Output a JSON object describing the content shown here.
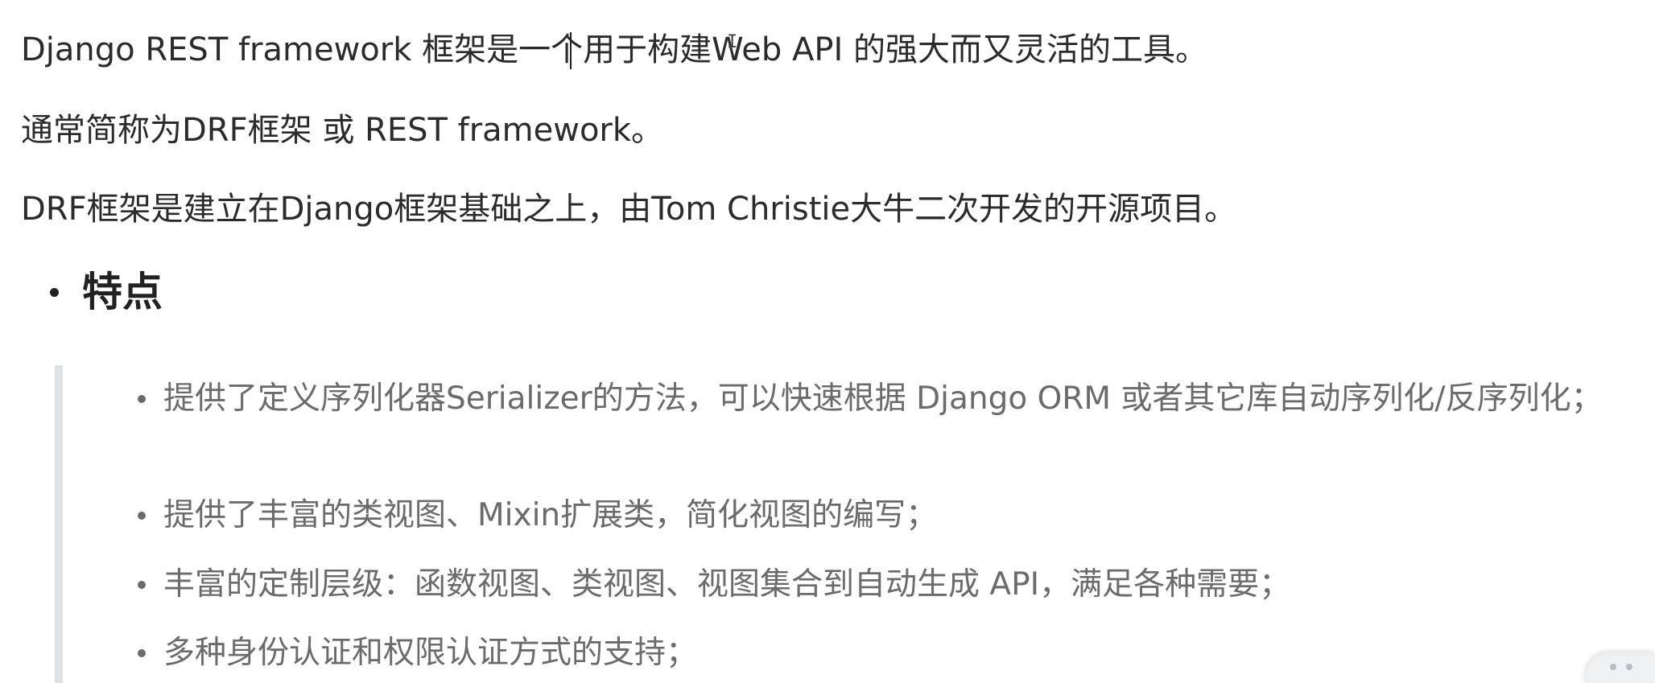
{
  "intro": {
    "line1": "Django REST framework 框架是一个用于构建Web API 的强大而又灵活的工具。",
    "line2": "通常简称为DRF框架 或 REST framework。",
    "line3": "DRF框架是建立在Django框架基础之上，由Tom Christie大牛二次开发的开源项目。"
  },
  "features": {
    "heading": "特点",
    "items": [
      "提供了定义序列化器Serializer的方法，可以快速根据 Django ORM 或者其它库自动序列化/反序列化；",
      "提供了丰富的类视图、Mixin扩展类，简化视图的编写；",
      "丰富的定制层级：函数视图、类视图、视图集合到自动生成 API，满足各种需要；",
      "多种身份认证和权限认证方式的支持；"
    ]
  },
  "colors": {
    "body_text": "#2b2b2b",
    "quote_text": "#6b6b6b",
    "quote_border": "#dfe2e5",
    "background": "#ffffff"
  },
  "icons": {
    "cursor": "ibeam-cursor-icon",
    "corner": "floating-widget-icon"
  }
}
